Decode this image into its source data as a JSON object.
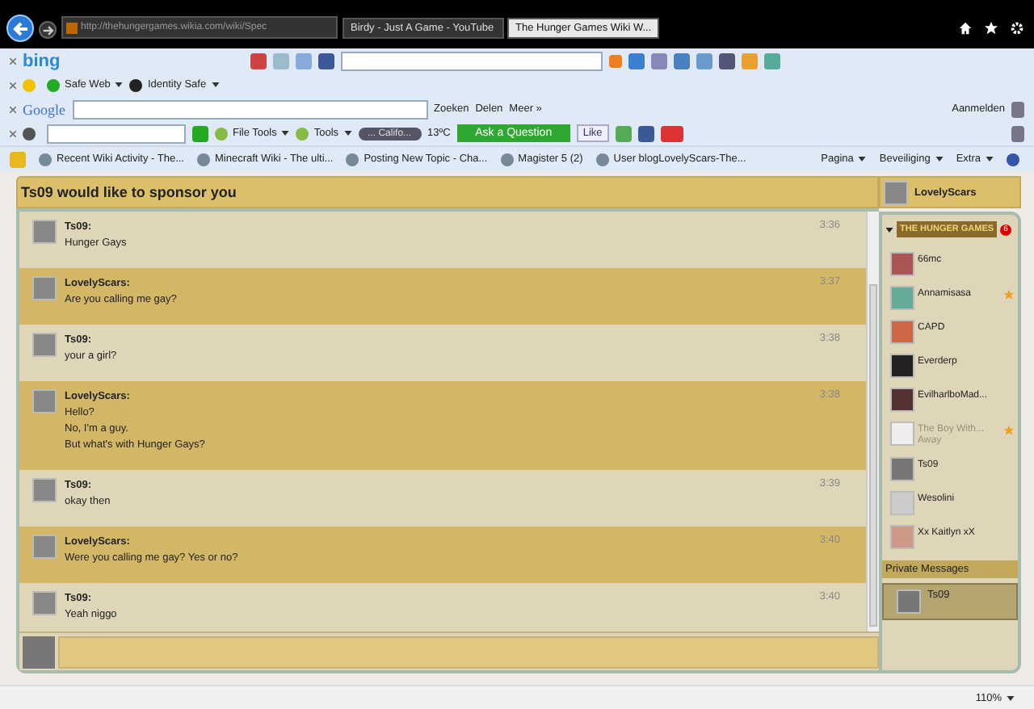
{
  "browser": {
    "address": "http://thehungergames.wikia.com/wiki/Spec",
    "tabs": [
      {
        "label": "Birdy - Just A Game - YouTube",
        "selected": false
      },
      {
        "label": "The Hunger Games Wiki W...",
        "selected": true
      }
    ]
  },
  "bing_bar": {
    "logo": "bing"
  },
  "norton_bar": {
    "items": [
      "Safe Web",
      "Identity Safe"
    ]
  },
  "google_bar": {
    "logo": "Google",
    "buttons": [
      "Zoeken",
      "Delen",
      "Meer »"
    ],
    "sign_in": "Aanmelden"
  },
  "addon_bar": {
    "buttons": [
      "File Tools",
      "Tools"
    ],
    "radio_station": "... Califo...",
    "temperature": "13ºC",
    "ask_button": "Ask a Question",
    "like_button": "Like"
  },
  "favorites_bar": {
    "items": [
      "Recent Wiki Activity - The...",
      "Minecraft Wiki - The ulti...",
      "Posting New Topic - Cha...",
      "Magister 5 (2)",
      "User blogLovelyScars-The..."
    ],
    "commands": [
      "Pagina",
      "Beveiliging",
      "Extra"
    ]
  },
  "chat": {
    "header": "Ts09 would like to sponsor you",
    "messages": [
      {
        "author": "Ts09:",
        "time": "3:36",
        "own": false,
        "lines": [
          "Hunger Gays"
        ]
      },
      {
        "author": "LovelyScars:",
        "time": "3:37",
        "own": true,
        "lines": [
          "Are you calling me gay?"
        ]
      },
      {
        "author": "Ts09:",
        "time": "3:38",
        "own": false,
        "lines": [
          "your a girl?"
        ]
      },
      {
        "author": "LovelyScars:",
        "time": "3:38",
        "own": true,
        "lines": [
          "Hello?",
          "No, I'm a guy.",
          "But what's with Hunger Gays?"
        ]
      },
      {
        "author": "Ts09:",
        "time": "3:39",
        "own": false,
        "lines": [
          "okay then"
        ]
      },
      {
        "author": "LovelyScars:",
        "time": "3:40",
        "own": true,
        "lines": [
          "Were you calling me gay? Yes or no?"
        ]
      },
      {
        "author": "Ts09:",
        "time": "3:40",
        "own": false,
        "lines": [
          "Yeah niggo"
        ]
      }
    ]
  },
  "sidebar": {
    "current_user": "LovelyScars",
    "wiki_logo": "THE HUNGER GAMES",
    "badge": "6",
    "users": [
      {
        "name": "66mc",
        "starred": false,
        "away": false
      },
      {
        "name": "Annamisasa",
        "starred": true,
        "away": false
      },
      {
        "name": "CAPD",
        "starred": false,
        "away": false
      },
      {
        "name": "Everderp",
        "starred": false,
        "away": false
      },
      {
        "name": "EvilharlboMad...",
        "starred": false,
        "away": false
      },
      {
        "name": "The Boy With...",
        "status": "Away",
        "starred": true,
        "away": true
      },
      {
        "name": "Ts09",
        "starred": false,
        "away": false
      },
      {
        "name": "Wesolini",
        "starred": false,
        "away": false
      },
      {
        "name": "Xx Kaitlyn xX",
        "starred": false,
        "away": false
      }
    ],
    "private_heading": "Private Messages",
    "private": [
      {
        "name": "Ts09",
        "selected": true
      }
    ]
  },
  "status_bar": {
    "zoom": "110%"
  }
}
